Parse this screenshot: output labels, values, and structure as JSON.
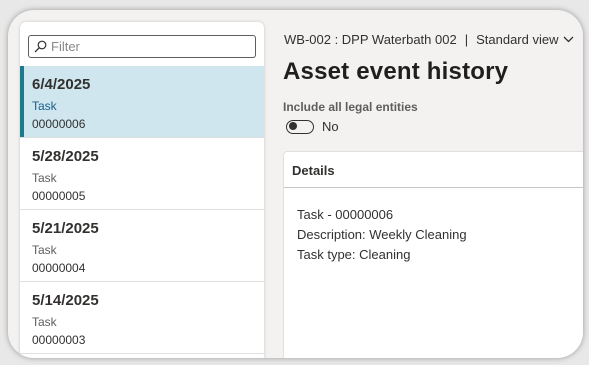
{
  "filter": {
    "placeholder": "Filter",
    "icon": "search-icon"
  },
  "list": {
    "items": [
      {
        "date": "6/4/2025",
        "type": "Task",
        "number": "00000006",
        "selected": true
      },
      {
        "date": "5/28/2025",
        "type": "Task",
        "number": "00000005",
        "selected": false
      },
      {
        "date": "5/21/2025",
        "type": "Task",
        "number": "00000004",
        "selected": false
      },
      {
        "date": "5/14/2025",
        "type": "Task",
        "number": "00000003",
        "selected": false
      }
    ]
  },
  "header": {
    "record": "WB-002 : DPP Waterbath 002",
    "separator": "|",
    "view_label": "Standard view"
  },
  "page": {
    "title": "Asset event history"
  },
  "legal_entities": {
    "label": "Include all legal entities",
    "value_text": "No",
    "on": false
  },
  "details": {
    "heading": "Details",
    "line1": "Task - 00000006",
    "line2": "Description: Weekly Cleaning",
    "line3": "Task type: Cleaning"
  },
  "colors": {
    "selected_row_bg": "#d0e6ee",
    "selected_accent": "#1b7a8e"
  }
}
